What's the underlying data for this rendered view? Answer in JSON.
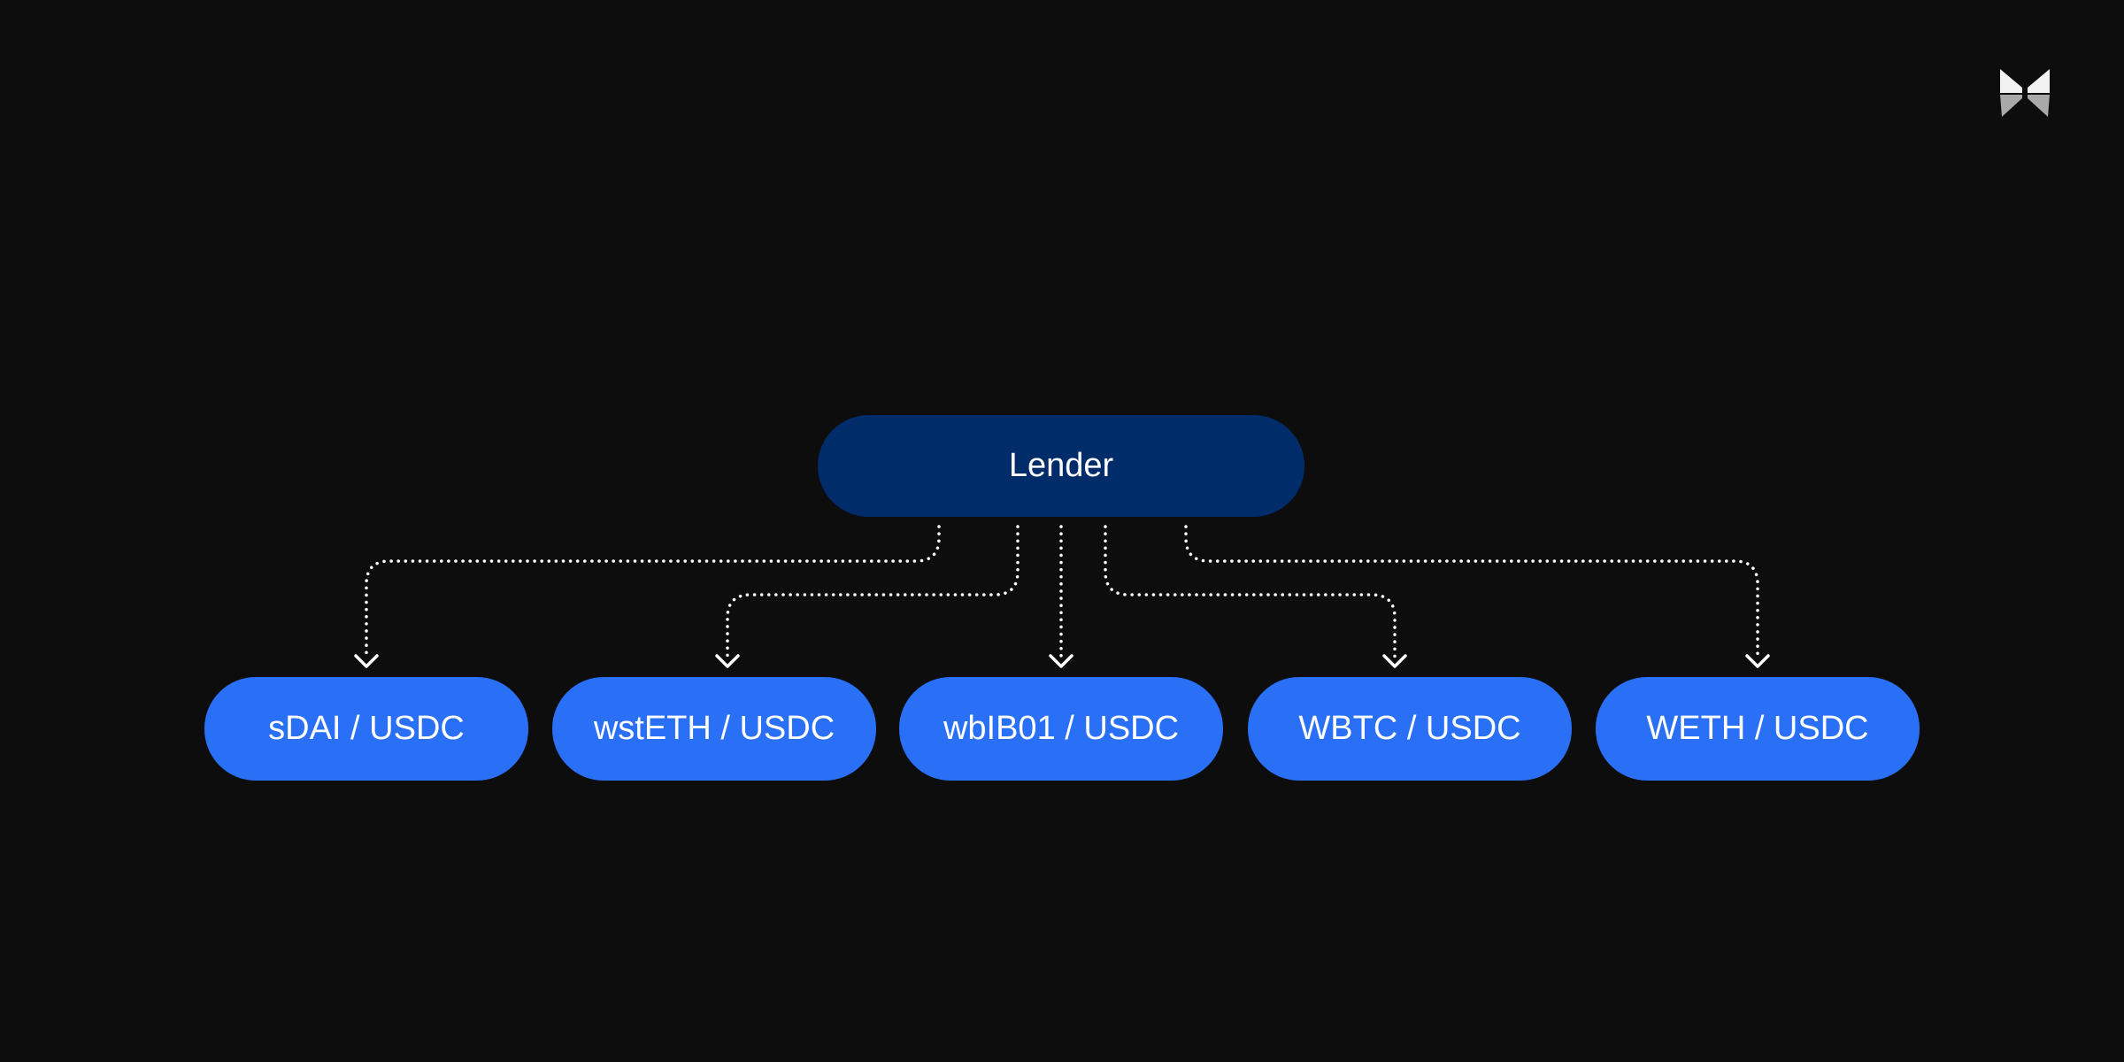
{
  "diagram": {
    "root": {
      "label": "Lender",
      "color": "#002d6a"
    },
    "children": [
      {
        "label": "sDAI / USDC"
      },
      {
        "label": "wstETH / USDC"
      },
      {
        "label": "wbIB01 / USDC"
      },
      {
        "label": "WBTC / USDC"
      },
      {
        "label": "WETH / USDC"
      }
    ],
    "child_color": "#2a70f6",
    "connector_style": "dotted-arrow",
    "background": "#0d0d0d"
  },
  "logo": {
    "icon": "butterfly-logo-icon"
  }
}
